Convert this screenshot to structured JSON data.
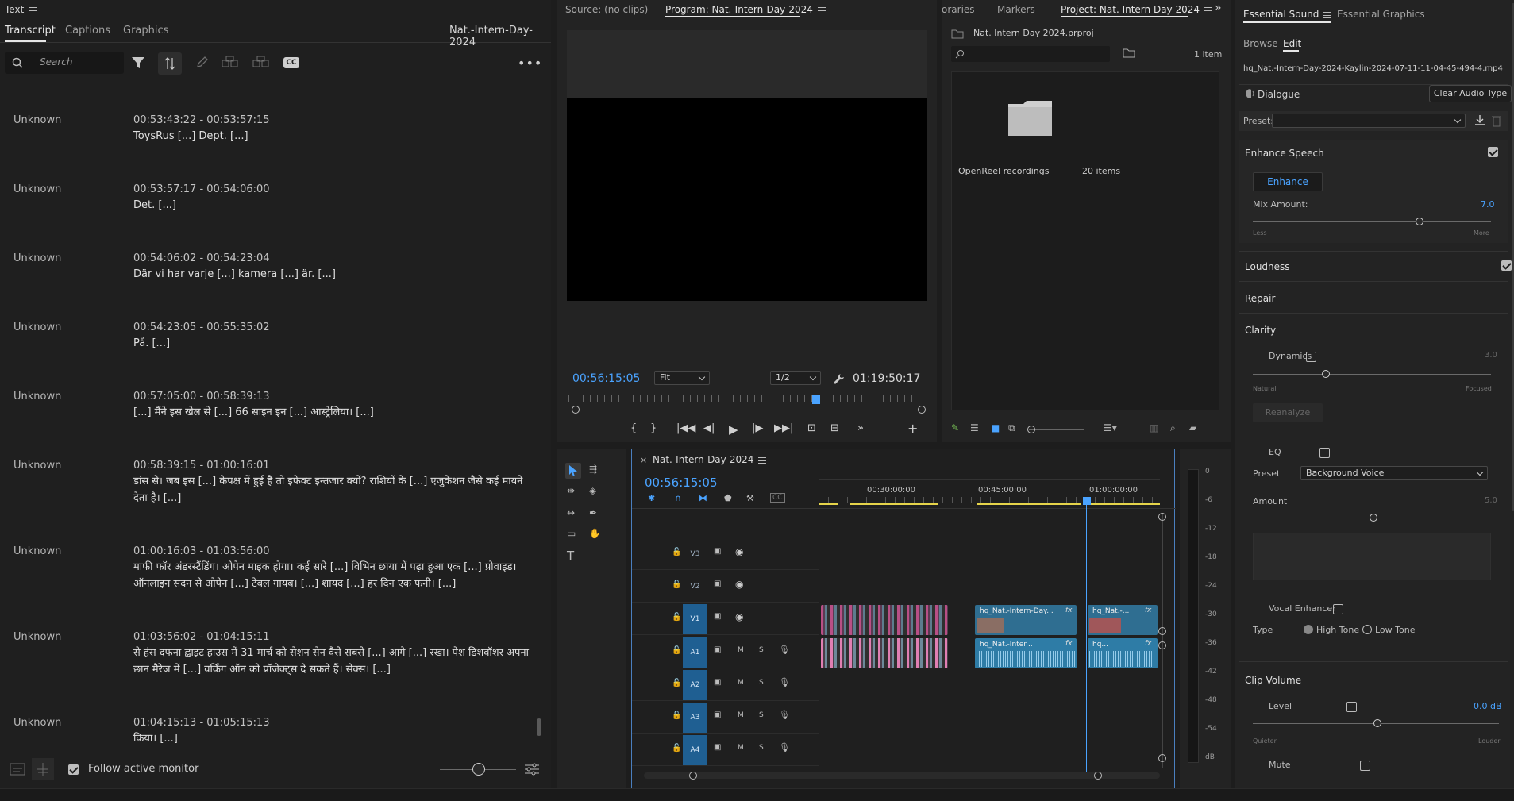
{
  "text_panel": {
    "title": "Text",
    "tabs": [
      "Transcript",
      "Captions",
      "Graphics"
    ],
    "sequence_name": "Nat.-Intern-Day-2024",
    "search_placeholder": "Search",
    "follow_label": "Follow active monitor",
    "entries": [
      {
        "speaker": "Unknown",
        "time": "00:53:43:22 - 00:53:57:15",
        "text": "ToysRus [...] Dept. [...]"
      },
      {
        "speaker": "Unknown",
        "time": "00:53:57:17 - 00:54:06:00",
        "text": "Det. [...]"
      },
      {
        "speaker": "Unknown",
        "time": "00:54:06:02 - 00:54:23:04",
        "text": "Där vi har varje [...] kamera [...] är. [...]"
      },
      {
        "speaker": "Unknown",
        "time": "00:54:23:05 - 00:55:35:02",
        "text": "På. [...]"
      },
      {
        "speaker": "Unknown",
        "time": "00:57:05:00 - 00:58:39:13",
        "text": "[...] मैंने इस खेल से [...] 66 साइन इन [...] आस्ट्रेलिया। [...]"
      },
      {
        "speaker": "Unknown",
        "time": "00:58:39:15 - 01:00:16:01",
        "text": "डांस से। जब इस [...] केपक्ष में हुई है तो इफेक्ट इन्तजार क्यों? राशियों के [...] एजुकेशन जैसे कई मायने देता है। [...]"
      },
      {
        "speaker": "Unknown",
        "time": "01:00:16:03 - 01:03:56:00",
        "text": "माफी फॉर अंडरस्टैंडिंग। ओपेन माइक होगा। कई सारे [...] विभिन छाया में पढ़ा हुआ एक [...] प्रोवाइड। ऑनलाइन सदन से ओपेन [...] टेबल गायब। [...] शायद [...] हर दिन एक फनी। [...]"
      },
      {
        "speaker": "Unknown",
        "time": "01:03:56:02 - 01:04:15:11",
        "text": "से हंस दफना ह्वाइट हाउस में 31 मार्च को सेशन सेन वैसे सबसे [...] आगे [...] रखा। पेश डिशवॉशर अपना छान मैरेज में [...] वर्किंग ऑन को प्रॉजेक्ट्स दे सकते हैं। सेक्स। [...]"
      },
      {
        "speaker": "Unknown",
        "time": "01:04:15:13 - 01:05:15:13",
        "text": "किया। [...]"
      }
    ]
  },
  "monitor": {
    "source_tab": "Source: (no clips)",
    "program_tab": "Program: Nat.-Intern-Day-2024",
    "timecode": "00:56:15:05",
    "fit": "Fit",
    "resolution": "1/2",
    "duration": "01:19:50:17"
  },
  "project": {
    "tabs": [
      "oraries",
      "Markers",
      "Project: Nat. Intern Day 2024"
    ],
    "file": "Nat. Intern Day 2024.prproj",
    "item_count": "1 item",
    "bin_name": "OpenReel recordings",
    "bin_items": "20 items"
  },
  "timeline": {
    "name": "Nat.-Intern-Day-2024",
    "timecode": "00:56:15:05",
    "ruler": [
      "00:30:00:00",
      "00:45:00:00",
      "01:00:00:00"
    ],
    "video_tracks": [
      "V3",
      "V2",
      "V1"
    ],
    "audio_tracks": [
      "A1",
      "A2",
      "A3",
      "A4"
    ],
    "clip_v1": "hq_Nat.-Intern-Day...",
    "clip_v1b": "hq_Nat.-...",
    "clip_a1": "hq_Nat.-Inter...",
    "clip_a1b": "hq...",
    "meter_labels": [
      "0",
      "-6",
      "-12",
      "-18",
      "-24",
      "-30",
      "-36",
      "-42",
      "-48",
      "-54",
      "dB"
    ]
  },
  "essential_sound": {
    "tabs": [
      "Essential Sound",
      "Essential Graphics"
    ],
    "subtabs": [
      "Browse",
      "Edit"
    ],
    "clip_name": "hq_Nat.-Intern-Day-2024-Kaylin-2024-07-11-11-04-45-494-4.mp4",
    "type": "Dialogue",
    "clear_btn": "Clear Audio Type",
    "preset_label": "Preset:",
    "enhance_speech": "Enhance Speech",
    "enhance_btn": "Enhance",
    "mix_amount": "Mix Amount:",
    "mix_value": "7.0",
    "less": "Less",
    "more": "More",
    "loudness": "Loudness",
    "repair": "Repair",
    "clarity": "Clarity",
    "dynamics": "Dynamics",
    "dynamics_value": "3.0",
    "natural": "Natural",
    "focused": "Focused",
    "reanalyze": "Reanalyze",
    "eq": "EQ",
    "preset2": "Preset",
    "preset2_value": "Background Voice",
    "amount": "Amount",
    "amount_value": "5.0",
    "vocal_enhancer": "Vocal Enhancer",
    "type_label": "Type",
    "high_tone": "High Tone",
    "low_tone": "Low Tone",
    "clip_volume": "Clip Volume",
    "level": "Level",
    "level_value": "0.0 dB",
    "quieter": "Quieter",
    "louder": "Louder",
    "mute": "Mute"
  }
}
